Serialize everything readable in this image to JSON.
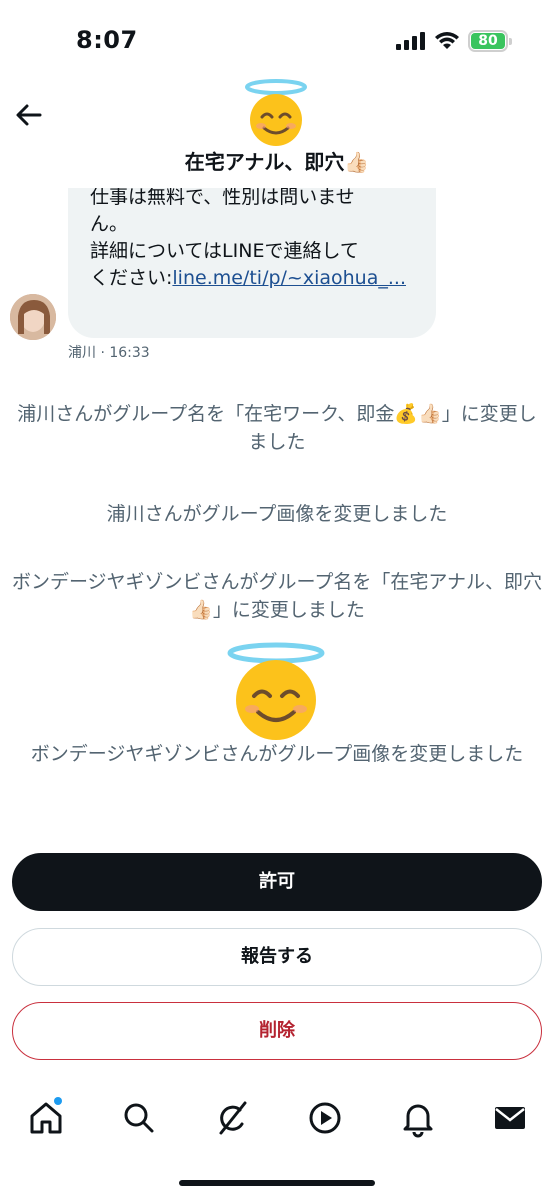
{
  "status_bar": {
    "time": "8:07",
    "battery": "80",
    "battery_color": "#3ac45e"
  },
  "header": {
    "back_icon": "arrow-left-icon",
    "avatar_icon": "smiling-face-with-halo-emoji",
    "title": "在宅アナル、即穴👍🏻"
  },
  "message": {
    "lines": [
      "仕事は無料で、性別は問いませ",
      "ん。",
      "詳細についてはLINEで連絡して"
    ],
    "prefix": "ください:",
    "link": "line.me/ti/p/~xiaohua_...",
    "sender": "浦川",
    "time": "· 16:33",
    "link_color": "#1d4f91"
  },
  "system_messages": [
    "浦川さんがグループ名を「在宅ワーク、即金💰👍🏻」に変更しました",
    "浦川さんがグループ画像を変更しました",
    "ボンデージヤギゾンビさんがグループ名を「在宅アナル、即穴👍🏻」に変更しました",
    "ボンデージヤギゾンビさんがグループ画像を変更しました"
  ],
  "actions": {
    "allow": "許可",
    "report": "報告する",
    "delete": "削除",
    "delete_color": "#b42330"
  },
  "nav": {
    "items": [
      "home-icon",
      "search-icon",
      "grok-icon",
      "video-icon",
      "notifications-icon",
      "messages-icon"
    ],
    "badge_color": "#1d9bf0"
  }
}
